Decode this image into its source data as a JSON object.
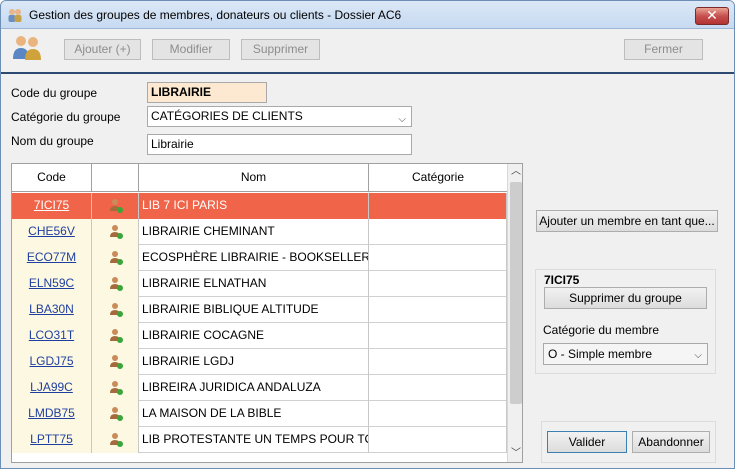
{
  "window": {
    "title": "Gestion des groupes de membres, donateurs ou clients - Dossier AC6",
    "close_glyph": "✕"
  },
  "toolbar": {
    "add_label": "Ajouter (+)",
    "edit_label": "Modifier",
    "delete_label": "Supprimer",
    "close_label": "Fermer"
  },
  "form": {
    "code_label": "Code du groupe",
    "code_value": "LIBRAIRIE",
    "category_label": "Catégorie du groupe",
    "category_value": "CATÉGORIES DE CLIENTS",
    "name_label": "Nom du groupe",
    "name_value": "Librairie"
  },
  "grid": {
    "columns": [
      "Code",
      "",
      "Nom",
      "Catégorie"
    ],
    "rows": [
      {
        "code": "7ICI75",
        "nom": "LIB 7 ICI PARIS",
        "categorie": "",
        "selected": true
      },
      {
        "code": "CHE56V",
        "nom": "LIBRAIRIE CHEMINANT",
        "categorie": ""
      },
      {
        "code": "ECO77M",
        "nom": "ECOSPHÈRE LIBRAIRIE - BOOKSELLER",
        "categorie": ""
      },
      {
        "code": "ELN59C",
        "nom": "LIBRAIRIE ELNATHAN",
        "categorie": ""
      },
      {
        "code": "LBA30N",
        "nom": "LIBRAIRIE BIBLIQUE ALTITUDE",
        "categorie": ""
      },
      {
        "code": "LCO31T",
        "nom": "LIBRAIRIE COCAGNE",
        "categorie": ""
      },
      {
        "code": "LGDJ75",
        "nom": "LIBRAIRIE LGDJ",
        "categorie": ""
      },
      {
        "code": "LJA99C",
        "nom": "LIBREIRA JURIDICA ANDALUZA",
        "categorie": ""
      },
      {
        "code": "LMDB75",
        "nom": "LA MAISON DE LA BIBLE",
        "categorie": ""
      },
      {
        "code": "LPTT75",
        "nom": "LIB PROTESTANTE UN TEMPS POUR TOUS",
        "categorie": ""
      }
    ]
  },
  "side": {
    "add_member_label": "Ajouter un membre en tant que...",
    "panel_title": "7ICI75",
    "remove_label": "Supprimer du groupe",
    "member_category_label": "Catégorie du membre",
    "member_category_value": "O - Simple membre"
  },
  "footer": {
    "validate_label": "Valider",
    "cancel_label": "Abandonner"
  },
  "colors": {
    "selected_row": "#f0654a",
    "code_column_bg": "#fdf8e1",
    "code_field_bg": "#fde9d2",
    "toolbar_line": "#2c4a72"
  }
}
